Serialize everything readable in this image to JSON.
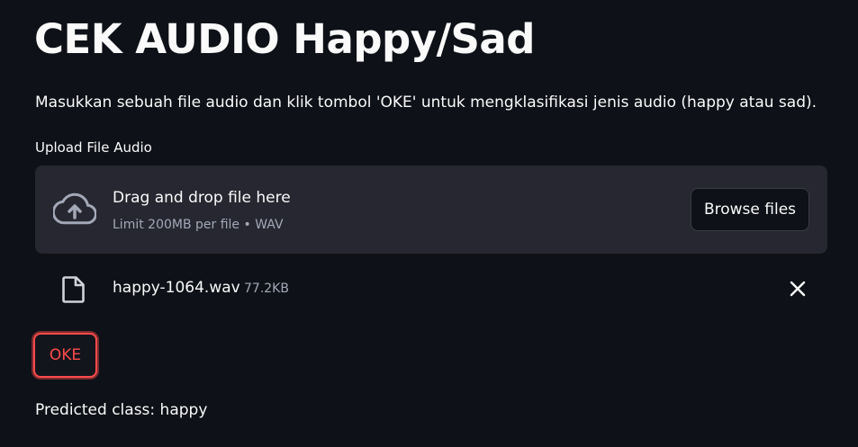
{
  "page": {
    "title": "CEK AUDIO Happy/Sad",
    "description": "Masukkan sebuah file audio dan klik tombol 'OKE' untuk mengklasifikasi jenis audio (happy atau sad)."
  },
  "uploader": {
    "label": "Upload File Audio",
    "drop_title": "Drag and drop file here",
    "drop_limit": "Limit 200MB per file • WAV",
    "browse_label": "Browse files",
    "icon": "cloud-upload-icon"
  },
  "uploaded_file": {
    "name": "happy-1064.wav",
    "size": "77.2KB",
    "icon": "file-icon",
    "remove_icon": "close-icon"
  },
  "actions": {
    "submit_label": "OKE"
  },
  "result": {
    "text": "Predicted class: happy"
  },
  "colors": {
    "background": "#0e1117",
    "panel": "#262730",
    "accent": "#ff4b4b",
    "text": "#fafafa",
    "muted": "#a3a8b8"
  }
}
